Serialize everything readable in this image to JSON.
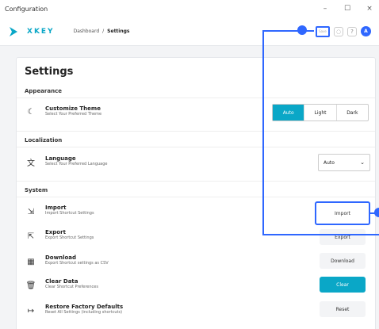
{
  "window": {
    "title": "Configuration",
    "controls": [
      "–",
      "☐",
      "×"
    ]
  },
  "appbar": {
    "brand": "XKEY",
    "breadcrumb": [
      "Dashboard",
      "Settings"
    ],
    "save_label": "Save",
    "avatar_initial": "A"
  },
  "settings": {
    "title": "Settings",
    "appearance": {
      "heading": "Appearance",
      "theme_title": "Customize Theme",
      "theme_sub": "Select Your Preferred Theme",
      "options": [
        "Auto",
        "Light",
        "Dark"
      ]
    },
    "localization": {
      "heading": "Localization",
      "lang_title": "Language",
      "lang_sub": "Select Your Preferred Language",
      "selected": "Auto"
    },
    "system": {
      "heading": "System",
      "import_title": "Import",
      "import_sub": "Import Shortcut Settings",
      "import_btn": "Import",
      "export_title": "Export",
      "export_sub": "Export Shortcut Settings",
      "export_btn": "Export",
      "download_title": "Download",
      "download_sub": "Export Shortcut settings as CSV",
      "download_btn": "Download",
      "clear_title": "Clear Data",
      "clear_sub": "Clear Shortcut Preferences",
      "clear_btn": "Clear",
      "reset_title": "Restore Factory Defaults",
      "reset_sub": "Reset All Settings (including shortcuts)",
      "reset_btn": "Reset"
    }
  },
  "colors": {
    "accent": "#0aa7c7",
    "annotation": "#2f67ff"
  }
}
